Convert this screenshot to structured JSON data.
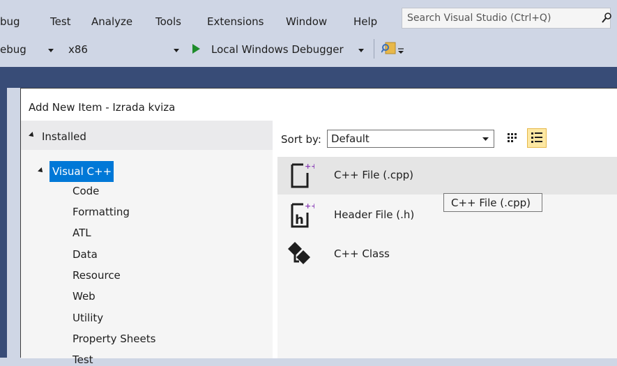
{
  "menu": {
    "items": [
      "bug",
      "Test",
      "Analyze",
      "Tools",
      "Extensions",
      "Window",
      "Help"
    ],
    "search_placeholder": "Search Visual Studio (Ctrl+Q)"
  },
  "toolbar": {
    "config_value": "ebug",
    "platform_value": "x86",
    "debugger_label": "Local Windows Debugger"
  },
  "dialog": {
    "title": "Add New Item - Izrada kviza",
    "installed_label": "Installed",
    "tree": {
      "selected_label": "Visual C++",
      "children": [
        "Code",
        "Formatting",
        "ATL",
        "Data",
        "Resource",
        "Web",
        "Utility",
        "Property Sheets",
        "Test"
      ]
    },
    "sort_label": "Sort by:",
    "sort_value": "Default",
    "templates": [
      {
        "label": "C++ File (.cpp)",
        "icon": "cpp-file-icon",
        "selected": true
      },
      {
        "label": "Header File (.h)",
        "icon": "header-file-icon",
        "selected": false
      },
      {
        "label": "C++ Class",
        "icon": "cpp-class-icon",
        "selected": false
      }
    ],
    "tooltip": "C++ File (.cpp)"
  },
  "colors": {
    "shell_bg": "#cfd6e5",
    "dark_band": "#384c77",
    "selection": "#0078d7",
    "play_green": "#1e8c2b",
    "purple_plus": "#8a3fb7"
  }
}
